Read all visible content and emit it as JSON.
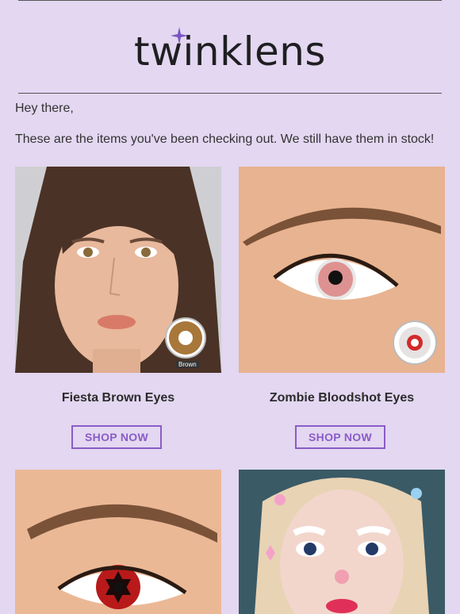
{
  "brand": {
    "name": "twinklens",
    "accent": "#8a5cc6",
    "background": "#e3d7f1"
  },
  "email": {
    "greeting": "Hey there,",
    "intro": "These are the items you've been checking out. We still have them in stock!"
  },
  "products": [
    {
      "title": "Fiesta Brown Eyes",
      "cta": "SHOP NOW",
      "swatch_label": "Brown"
    },
    {
      "title": "Zombie Bloodshot Eyes",
      "cta": "SHOP NOW"
    },
    {
      "title": "",
      "cta": ""
    },
    {
      "title": "",
      "cta": ""
    }
  ]
}
